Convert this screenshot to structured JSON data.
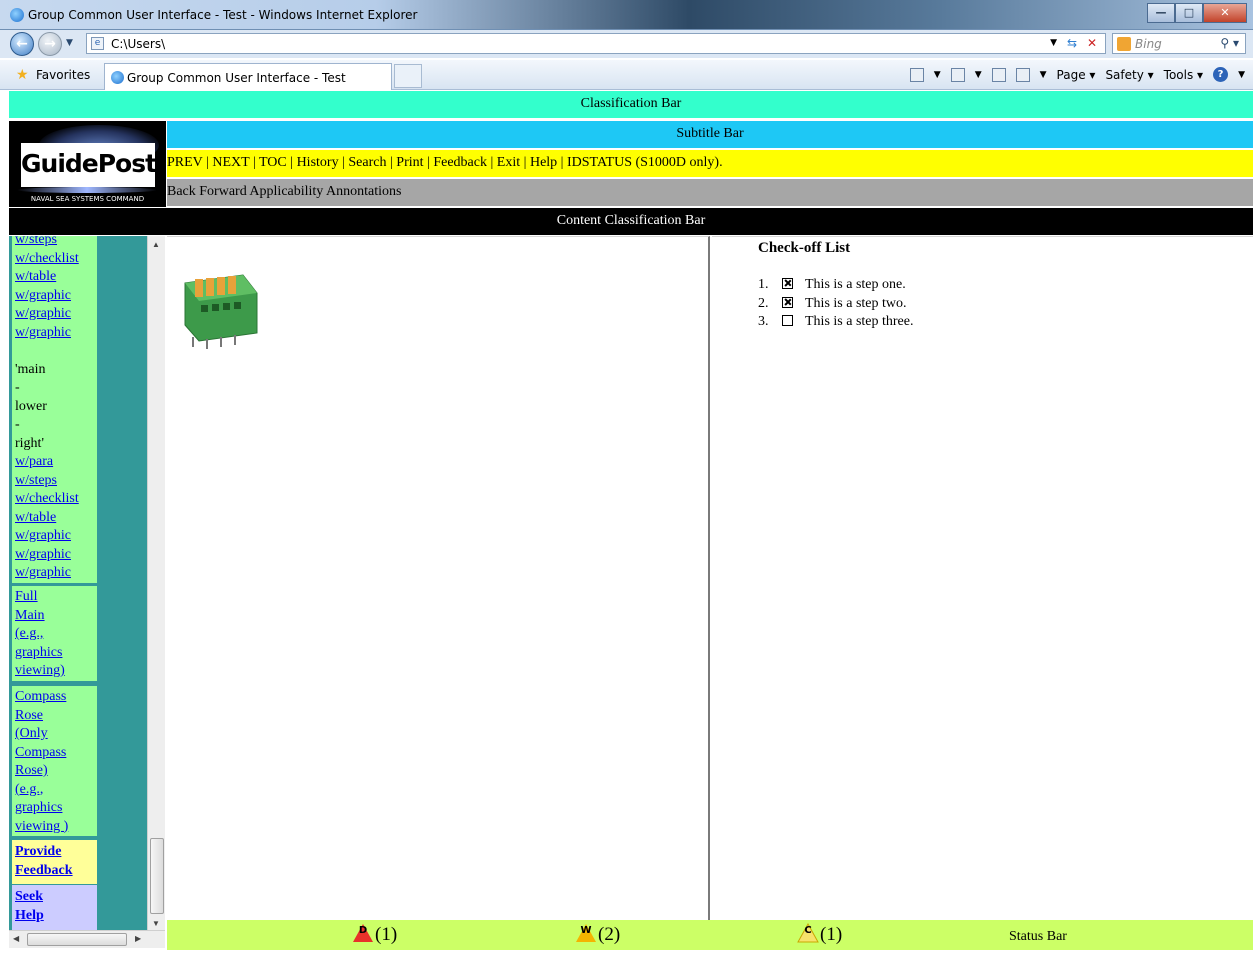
{
  "browser": {
    "window_title": "Group Common User Interface - Test - Windows Internet Explorer",
    "address": "C:\\Users\\",
    "search_placeholder": "Bing",
    "favorites_label": "Favorites",
    "tab_title": "Group Common User Interface - Test",
    "commands": [
      "Page",
      "Safety",
      "Tools"
    ]
  },
  "page": {
    "classification_bar": "Classification Bar",
    "subtitle_bar": "Subtitle Bar",
    "content_classification_bar": "Content Classification Bar",
    "logo": {
      "brand": "GuidePost",
      "subtitle": "NAVAL SEA SYSTEMS COMMAND"
    },
    "nav_links": [
      "PREV",
      "NEXT",
      "TOC",
      "History",
      "Search",
      "Print",
      "Feedback",
      "Exit",
      "Help"
    ],
    "nav_tail": "IDSTATUS (S1000D only).",
    "toolbar_text": "Back Forward Applicability Annontations",
    "sidebar": {
      "section1": [
        {
          "text": "w/steps",
          "link": true
        },
        {
          "text": "w/checklist",
          "link": true
        },
        {
          "text": "w/table",
          "link": true
        },
        {
          "text": "w/graphic",
          "link": true
        },
        {
          "text": "w/graphic",
          "link": true
        },
        {
          "text": "w/graphic",
          "link": true
        },
        {
          "text": "",
          "link": false
        },
        {
          "text": "'main",
          "link": false
        },
        {
          "text": "-",
          "link": false
        },
        {
          "text": "lower",
          "link": false
        },
        {
          "text": "-",
          "link": false
        },
        {
          "text": "right'",
          "link": false
        },
        {
          "text": "w/para",
          "link": true
        },
        {
          "text": "w/steps",
          "link": true
        },
        {
          "text": "w/checklist",
          "link": true
        },
        {
          "text": "w/table",
          "link": true
        },
        {
          "text": "w/graphic",
          "link": true
        },
        {
          "text": "w/graphic",
          "link": true
        },
        {
          "text": "w/graphic",
          "link": true
        }
      ],
      "section2": [
        "Full",
        "Main",
        "(e.g.,",
        "graphics",
        "viewing)"
      ],
      "section3": [
        "Compass",
        "Rose",
        "(Only",
        "Compass",
        "Rose)",
        "(e.g.,",
        "graphics",
        "viewing )"
      ],
      "feedback": [
        "Provide",
        "Feedback"
      ],
      "help": [
        "Seek",
        "Help"
      ]
    },
    "checklist": {
      "title": "Check-off List",
      "steps": [
        {
          "num": "1.",
          "text": "This is a step one.",
          "checked": true
        },
        {
          "num": "2.",
          "text": "This is a step two.",
          "checked": true
        },
        {
          "num": "3.",
          "text": "This is a step three.",
          "checked": false
        }
      ]
    },
    "status": {
      "indicators": [
        {
          "letter": "D",
          "count": "(1)",
          "color": "#e8322a"
        },
        {
          "letter": "W",
          "count": "(2)",
          "color": "#f4b400"
        },
        {
          "letter": "C",
          "count": "(1)",
          "color": "#f7e26b"
        }
      ],
      "status_text": "Status Bar"
    }
  }
}
